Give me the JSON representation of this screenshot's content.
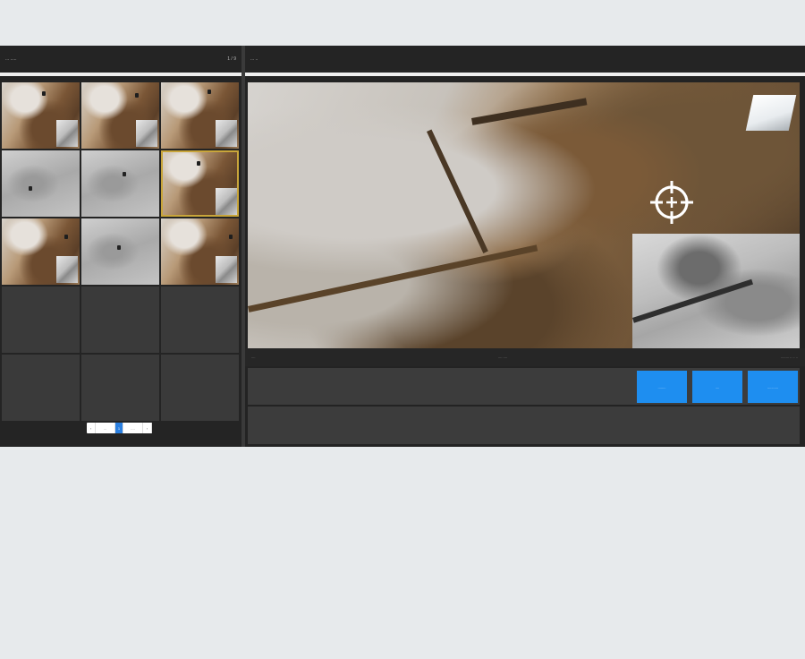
{
  "left_panel": {
    "title": "... .....",
    "count": "1 / 9"
  },
  "right_panel": {
    "title": "... .."
  },
  "thumbnails": [
    {
      "kind": "rgb",
      "selected": false
    },
    {
      "kind": "rgb",
      "selected": false
    },
    {
      "kind": "rgb",
      "selected": false
    },
    {
      "kind": "gray",
      "selected": false
    },
    {
      "kind": "gray",
      "selected": false
    },
    {
      "kind": "rgb",
      "selected": true
    },
    {
      "kind": "rgb",
      "selected": false
    },
    {
      "kind": "gray",
      "selected": false
    },
    {
      "kind": "rgb",
      "selected": false
    },
    {
      "kind": "empty",
      "selected": false
    },
    {
      "kind": "empty",
      "selected": false
    },
    {
      "kind": "empty",
      "selected": false
    },
    {
      "kind": "empty",
      "selected": false
    },
    {
      "kind": "empty",
      "selected": false
    },
    {
      "kind": "empty",
      "selected": false
    }
  ],
  "pagination": {
    "prev_symbol": "‹",
    "prev_label": "...",
    "current_page": "1",
    "next_label": "....",
    "next_symbol": "›"
  },
  "status_bar": {
    "left": "....",
    "middle": ".... ....",
    "right": "........ .. .. .."
  },
  "actions": {
    "button_1": "........",
    "button_2": "....",
    "button_3": "..........."
  },
  "icons": {
    "reticle": "crosshair-icon"
  },
  "colors": {
    "accent": "#1e8ef0",
    "selected_outline": "#c8a53a",
    "panel_bg": "#242424",
    "row_bg": "#3c3c3c"
  }
}
